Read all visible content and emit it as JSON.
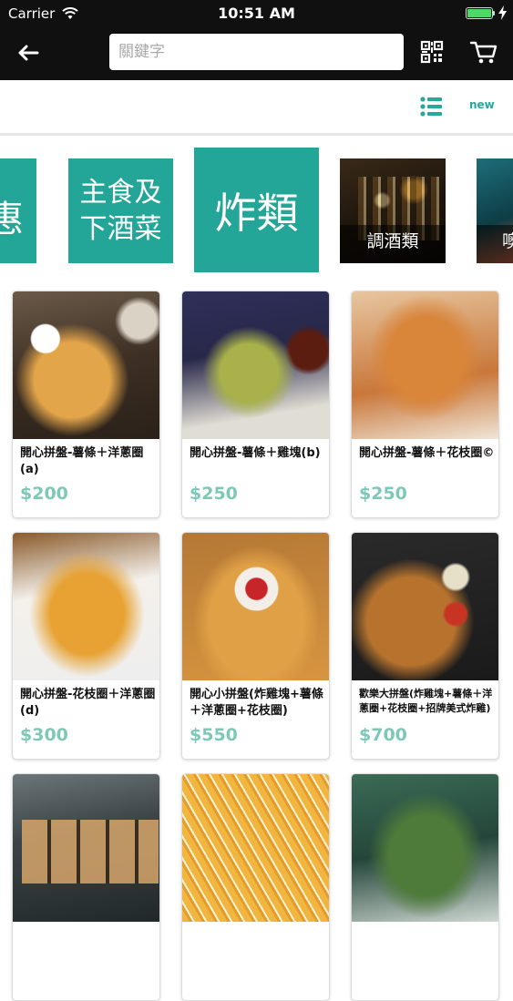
{
  "status_bar": {
    "carrier": "Carrier",
    "time": "10:51 AM",
    "battery_level": 1.0,
    "icons": [
      "wifi-icon",
      "battery-icon",
      "charging-bolt-icon"
    ]
  },
  "nav": {
    "back_icon": "arrow-left-icon",
    "search_placeholder": "關鍵字",
    "search_value": "",
    "qr_icon": "qr-code-icon",
    "cart_icon": "shopping-cart-icon"
  },
  "toolbar": {
    "list_icon": "list-view-icon",
    "new_label": "new"
  },
  "categories": [
    {
      "label": "惠",
      "style": "teal"
    },
    {
      "label_line1": "主食及",
      "label_line2": "下酒菜",
      "style": "teal"
    },
    {
      "label": "炸類",
      "style": "teal-selected"
    },
    {
      "label": "調酒類",
      "style": "photo"
    },
    {
      "label": "噢",
      "style": "photo"
    }
  ],
  "products": [
    {
      "name": "開心拼盤-薯條＋洋蔥圈(a)",
      "price": "$200"
    },
    {
      "name": "開心拼盤-薯條＋雞塊(b)",
      "price": "$250"
    },
    {
      "name": "開心拼盤-薯條＋花枝圈©",
      "price": "$250"
    },
    {
      "name": "開心拼盤-花枝圈＋洋蔥圈(d)",
      "price": "$300"
    },
    {
      "name": "開心小拼盤(炸雞塊+薯條＋洋蔥圈+花枝圈)",
      "price": "$550"
    },
    {
      "name": "歡樂大拼盤(炸雞塊+薯條＋洋蔥圈+花枝圈+招牌美式炸雞)",
      "price": "$700"
    },
    {
      "name": "",
      "price": ""
    },
    {
      "name": "",
      "price": ""
    },
    {
      "name": "",
      "price": ""
    }
  ],
  "colors": {
    "accent": "#23a597",
    "price": "#7ec8b8",
    "topbar": "#101010",
    "battery": "#4cd964"
  }
}
